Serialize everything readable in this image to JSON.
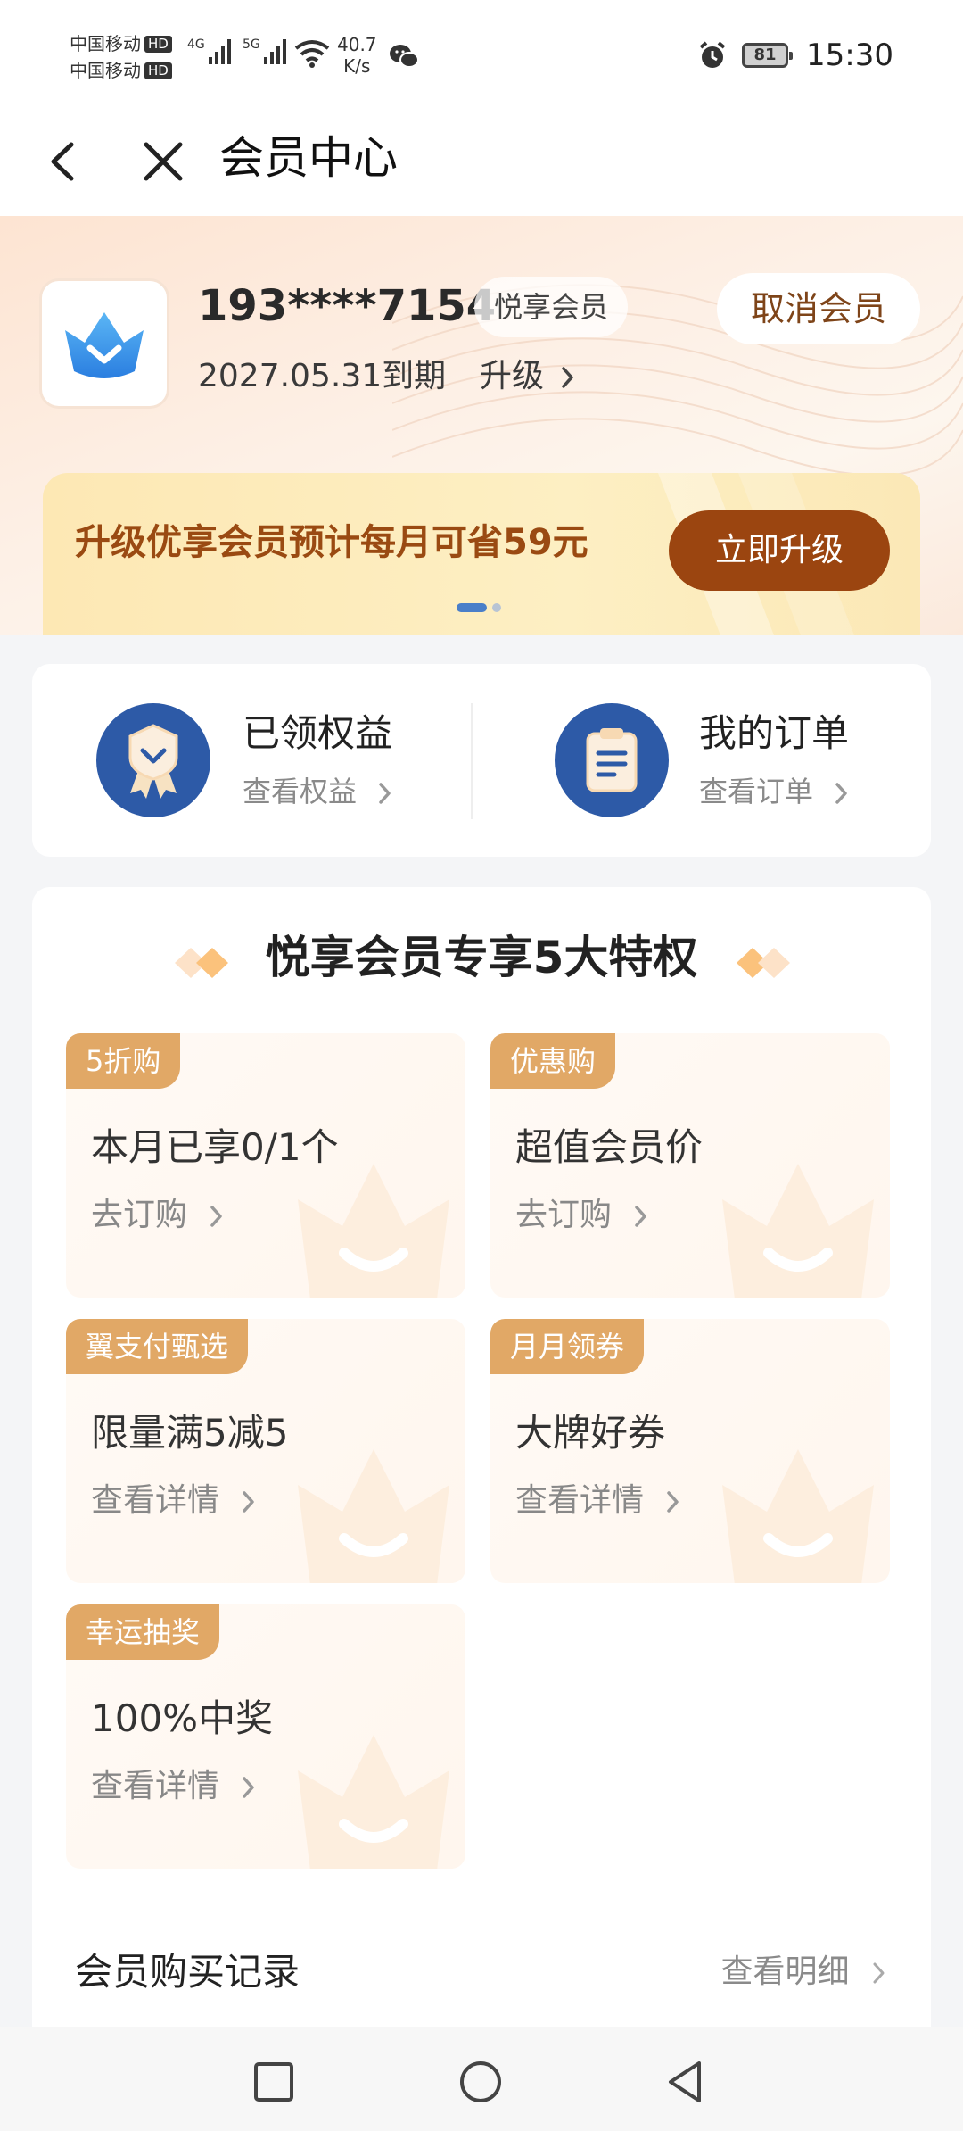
{
  "status_bar": {
    "carrier1": "中国移动",
    "carrier2": "中国移动",
    "hd": "HD",
    "net1": "4G",
    "net2": "5G",
    "speed_value": "40.7",
    "speed_unit": "K/s",
    "battery": "81",
    "time": "15:30"
  },
  "nav": {
    "title": "会员中心"
  },
  "member": {
    "phone": "193****7154",
    "tier": "悦享会员",
    "cancel_label": "取消会员",
    "expiry": "2027.05.31到期",
    "upgrade_label": "升级"
  },
  "banner": {
    "text": "升级优享会员预计每月可省59元",
    "button": "立即升级"
  },
  "quick": [
    {
      "title": "已领权益",
      "sub": "查看权益"
    },
    {
      "title": "我的订单",
      "sub": "查看订单"
    }
  ],
  "privileges": {
    "title": "悦享会员专享5大特权",
    "tiles": [
      {
        "tag": "5折购",
        "main": "本月已享0/1个",
        "link": "去订购"
      },
      {
        "tag": "优惠购",
        "main": "超值会员价",
        "link": "去订购"
      },
      {
        "tag": "翼支付甄选",
        "main": "限量满5减5",
        "link": "查看详情"
      },
      {
        "tag": "月月领券",
        "main": "大牌好券",
        "link": "查看详情"
      },
      {
        "tag": "幸运抽奖",
        "main": "100%中奖",
        "link": "查看详情"
      }
    ]
  },
  "records": {
    "title": "会员购买记录",
    "link": "查看明细"
  },
  "colors": {
    "brand_brown": "#9b4510",
    "tag_gold": "#e1a866",
    "icon_blue": "#2d5aa7"
  }
}
